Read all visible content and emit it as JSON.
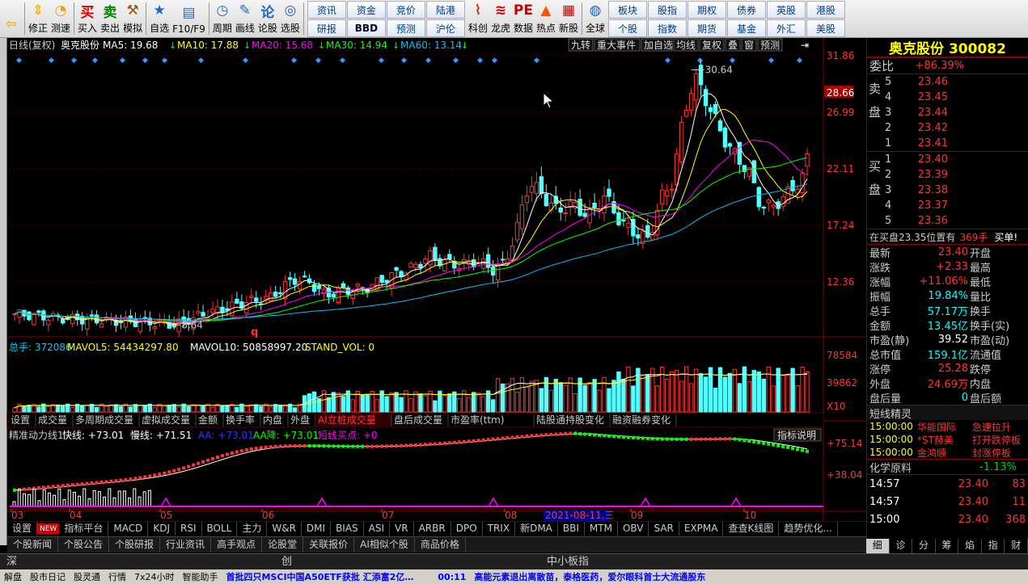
{
  "toolbar": {
    "buttons": [
      {
        "label": "",
        "icon": "back-arrow-icon"
      },
      {
        "label": "修正",
        "icon": "up-down-arrows-icon"
      },
      {
        "label": "测速",
        "icon": "speed-gauge-icon"
      },
      {
        "label": "买入",
        "icon": "buy-icon",
        "glyph": "买"
      },
      {
        "label": "卖出",
        "icon": "sell-icon",
        "glyph": "卖"
      },
      {
        "label": "模拟",
        "icon": "gavel-icon"
      },
      {
        "label": "自选",
        "icon": "star-icon"
      },
      {
        "label": "F10/F9",
        "icon": "f10-icon"
      },
      {
        "label": "周期",
        "icon": "clock-icon"
      },
      {
        "label": "画线",
        "icon": "pencil-icon"
      },
      {
        "label": "论股",
        "icon": "lun-icon",
        "glyph": "论"
      },
      {
        "label": "选股",
        "icon": "select-stock-icon"
      }
    ],
    "grid1": [
      "资讯",
      "研报",
      "资金",
      "BBD",
      "竞价",
      "预测",
      "陆港",
      "沪伦"
    ],
    "big_buttons": [
      {
        "label": "科创",
        "icon": "kechuang-icon"
      },
      {
        "label": "龙虎",
        "icon": "longhu-icon"
      },
      {
        "label": "数据",
        "icon": "pe-icon",
        "glyph": "PE"
      },
      {
        "label": "热点",
        "icon": "hot-icon"
      },
      {
        "label": "新股",
        "icon": "new-stock-icon"
      },
      {
        "label": "全球",
        "icon": "globe-icon"
      }
    ],
    "grid2": [
      "板块",
      "个股",
      "股指",
      "指数",
      "期权",
      "期货",
      "债券",
      "基金",
      "英股",
      "外汇",
      "港股",
      "美股"
    ]
  },
  "chart_header": {
    "period": "日线(复权)",
    "stock": "奥克股份",
    "ma5": "MA5: 19.68",
    "ma10": "MA10: 17.88",
    "ma20": "MA20: 15.68",
    "ma30": "MA30: 14.94",
    "ma60": "MA60: 13.14",
    "buttons": [
      "九转",
      "重大事件",
      "加自选",
      "均线",
      "复权",
      "叠",
      "窗",
      "预测"
    ]
  },
  "volume_header": {
    "total": "总手: 372086",
    "mavol5": "MAVOL5: 54434297.80",
    "mavol10": "MAVOL10: 50858997.20",
    "stand": "STAND_VOL: 0"
  },
  "vol_tabs": [
    "设置",
    "成交量",
    "多周期成交量",
    "虚拟成交量",
    "金额",
    "换手率",
    "内盘",
    "外盘",
    "AI立桩成交量",
    "盘后成交量",
    "市盈率(ttm)",
    "陆股通持股变化",
    "融资融券变化"
  ],
  "indicator_header": {
    "name": "精准动力线1",
    "fast": "快线: +73.01",
    "slow": "慢线: +71.51",
    "aa": "AA: +73.01",
    "aa_drop": "AA降: +73.01",
    "buy": "短线买点: +0",
    "help": "指标说明"
  },
  "price_axis": [
    "31.86",
    "28.66",
    "26.99",
    "22.11",
    "17.24",
    "12.36"
  ],
  "vol_axis": [
    "78584",
    "39862",
    "X10"
  ],
  "ind_axis": [
    "+75.14",
    "+38.04"
  ],
  "peak_label": "30.64",
  "low_label": "8.64",
  "marker_label": "q",
  "date_axis": [
    "03",
    "04",
    "05",
    "06",
    "07",
    "08",
    "09",
    "10"
  ],
  "date_highlight": "2021-08-11,三",
  "ind_tabs": [
    "设置",
    "指标平台",
    "MACD",
    "KDJ",
    "RSI",
    "BOLL",
    "主力",
    "W&R",
    "DMI",
    "BIAS",
    "ASI",
    "VR",
    "ARBR",
    "DPO",
    "TRIX",
    "新DMA",
    "BBI",
    "MTM",
    "OBV",
    "SAR",
    "EXPMA",
    "查查K线图",
    "趋势优化..."
  ],
  "news_tabs": [
    "个股新闻",
    "个股公告",
    "个股研报",
    "行业资讯",
    "高手观点",
    "论股堂",
    "关联报价",
    "AI相似个股",
    "商品价格"
  ],
  "news_badge": "NEW",
  "right_panel": {
    "title": "奥克股份 300082",
    "weibi_label": "委比",
    "weibi_value": "+86.39%",
    "sell_label": "卖盘",
    "buy_label": "买盘",
    "sell": [
      {
        "lvl": "5",
        "price": "23.46"
      },
      {
        "lvl": "4",
        "price": "23.45"
      },
      {
        "lvl": "3",
        "price": "23.44"
      },
      {
        "lvl": "2",
        "price": "23.42"
      },
      {
        "lvl": "1",
        "price": "23.41"
      }
    ],
    "buy": [
      {
        "lvl": "1",
        "price": "23.40"
      },
      {
        "lvl": "2",
        "price": "23.39"
      },
      {
        "lvl": "3",
        "price": "23.38"
      },
      {
        "lvl": "4",
        "price": "23.37"
      },
      {
        "lvl": "5",
        "price": "23.36"
      }
    ],
    "inbuy_text": "在买盘23.35位置有",
    "inbuy_vol": "369手",
    "inbuy_action": "买单!",
    "stats": [
      {
        "k": "最新",
        "v": "23.40",
        "c": "red",
        "k2": "开盘"
      },
      {
        "k": "涨跌",
        "v": "+2.33",
        "c": "red",
        "k2": "最高"
      },
      {
        "k": "涨幅",
        "v": "+11.06%",
        "c": "red",
        "k2": "最低"
      },
      {
        "k": "振幅",
        "v": "19.84%",
        "c": "cyn",
        "k2": "量比"
      },
      {
        "k": "总手",
        "v": "57.17万",
        "c": "cyn",
        "k2": "换手"
      },
      {
        "k": "金额",
        "v": "13.45亿",
        "c": "cyn",
        "k2": "换手(实)"
      },
      {
        "k": "市盈(静)",
        "v": "39.52",
        "c": "wht",
        "k2": "市盈(动)"
      },
      {
        "k": "总市值",
        "v": "159.1亿",
        "c": "cyn",
        "k2": "流通值"
      },
      {
        "k": "涨停",
        "v": "25.28",
        "c": "red",
        "k2": "跌停"
      },
      {
        "k": "外盘",
        "v": "24.69万",
        "c": "red",
        "k2": "内盘"
      },
      {
        "k": "盘后量",
        "v": "0",
        "c": "cyn",
        "k2": "盘后额"
      }
    ],
    "short_title": "短线精灵",
    "short_items": [
      {
        "t": "15:00:00",
        "n": "华能国际",
        "e": "急速拉升"
      },
      {
        "t": "15:00:00",
        "n": "*ST赫美",
        "e": "打开跌停板"
      },
      {
        "t": "15:00:00",
        "n": "金鸿顺",
        "e": "封涨停板"
      }
    ],
    "sector": "化学原料",
    "sector_change": "-1.13%",
    "ticks": [
      {
        "t": "14:57",
        "p": "23.40",
        "v": "83"
      },
      {
        "t": "14:57",
        "p": "23.40",
        "v": "11"
      },
      {
        "t": "15:00",
        "p": "23.40",
        "v": "368"
      }
    ],
    "tabs": [
      "细",
      "诊",
      "分",
      "筹",
      "焰",
      "指",
      "财"
    ]
  },
  "index_bar": [
    "深",
    "创",
    "中小板指"
  ],
  "status_bar": {
    "items": [
      "解盘",
      "股市日记",
      "股灵通",
      "行情",
      "7x24小时",
      "智能助手"
    ],
    "ticker": "首批四只MSCI中国A50ETF获批 汇添富2亿…",
    "time": "00:11",
    "news": "高能元素退出离散苗，泰格医药，爱尔眼科首士大流通股东"
  },
  "colors": {
    "up": "#ff3333",
    "down": "#54ffff",
    "ma5": "#ffffff",
    "ma10": "#ffff00",
    "ma20": "#ff00ff",
    "ma30": "#00ff00",
    "ma60": "#00bfff"
  }
}
